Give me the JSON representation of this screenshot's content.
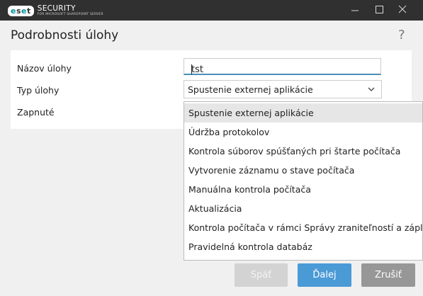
{
  "window": {
    "brand": "eset",
    "brand_line1": "SECURITY",
    "brand_line2": "FOR MICROSOFT SHAREPOINT SERVER",
    "controls": [
      "minimize-icon",
      "maximize-icon",
      "close-icon"
    ]
  },
  "header": {
    "title": "Podrobnosti úlohy",
    "help": "?"
  },
  "form": {
    "name_label": "Názov úlohy",
    "name_value": "tst",
    "type_label": "Typ úlohy",
    "type_value": "Spustenie externej aplikácie",
    "enabled_label": "Zapnuté"
  },
  "dropdown": {
    "options": [
      "Spustenie externej aplikácie",
      "Údržba protokolov",
      "Kontrola súborov spúšťaných pri štarte počítača",
      "Vytvorenie záznamu o stave počítača",
      "Manuálna kontrola počítača",
      "Aktualizácia",
      "Kontrola počítača v rámci Správy zraniteľností a záplat",
      "Pravidelná kontrola databáz"
    ],
    "selected_index": 0
  },
  "buttons": {
    "back": "Späť",
    "next": "Ďalej",
    "cancel": "Zrušiť"
  },
  "colors": {
    "titlebar": "#303030",
    "accent": "#4a9ad6",
    "brand_teal": "#0096a1"
  }
}
